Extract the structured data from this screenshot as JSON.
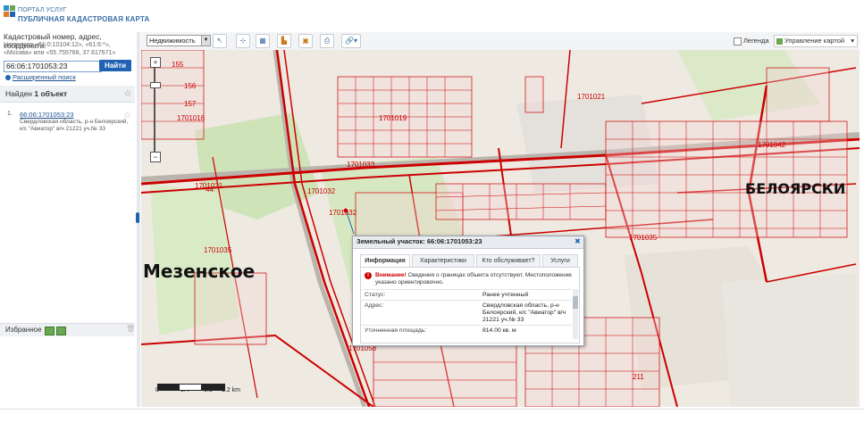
{
  "header": {
    "brand_line1": "ПОРТАЛ УСЛУГ",
    "brand_line2": "ПУБЛИЧНАЯ КАДАСТРОВАЯ КАРТА"
  },
  "sidebar": {
    "search_label": "Кадастровый номер, адрес, координата:",
    "search_hint": "Например «61:0:10104:12», «61:6:*», «Москва» или «55.755768, 37.617671»",
    "search_value": "66:06:1701053:23",
    "find_button": "Найти",
    "advanced_search": "Расширенный поиск",
    "found_prefix": "Найден",
    "found_count": "1 объект",
    "result": {
      "index": "1.",
      "cadastral_number": "66:06:1701053:23",
      "address": "Свердловская область, р-н Белоярский, к/с \"Авиатор\" в/ч 21221 уч.№ 33"
    },
    "favorites_label": "Избранное"
  },
  "toolbar": {
    "layer_select": "Недвижимость",
    "legend_label": "Легенда",
    "map_management": "Управление картой"
  },
  "map": {
    "parcel_labels": [
      "1701021",
      "1701019",
      "1701032",
      "1701031",
      "1701035",
      "1701042",
      "1701033",
      "1701058",
      "1701016",
      "1701035",
      "1701032",
      "156",
      "155",
      "157",
      "44",
      "211"
    ],
    "town_labels": [
      "Мезенское",
      "БЕЛОЯРСКИ"
    ],
    "scale_ticks": [
      "0",
      "0.4",
      "0.8",
      "1.2 km"
    ]
  },
  "popup": {
    "title": "Земельный участок: 66:06:1701053:23",
    "tabs": [
      "Информация",
      "Характеристики",
      "Кто обслуживает?",
      "Услуги"
    ],
    "warning_bold": "Внимание!",
    "warning_text": "Сведения о границах объекта отсутствуют. Местоположение указано ориентировочно.",
    "rows": [
      {
        "key": "Статус:",
        "value": "Ранее учтенный"
      },
      {
        "key": "Адрес:",
        "value": "Свердловская область, р-н Белоярский, к/с \"Авиатор\" в/ч 21221 уч.№ 33"
      },
      {
        "key": "Уточненная площадь:",
        "value": "814.00 кв. м"
      }
    ]
  },
  "colors": {
    "accent": "#1f63b2",
    "parcel_red": "#cc0000",
    "map_bg": "#f4f1ec"
  }
}
